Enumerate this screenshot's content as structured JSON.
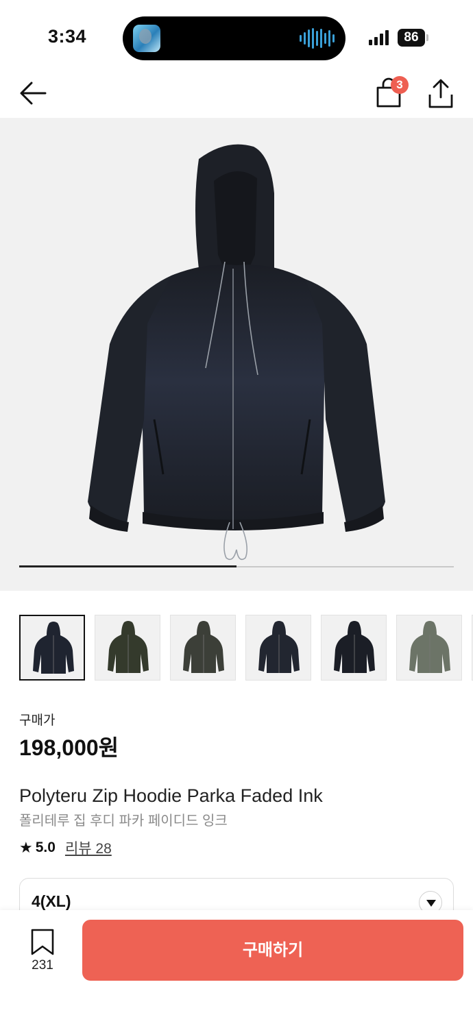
{
  "status_bar": {
    "time": "3:34",
    "battery": "86"
  },
  "header": {
    "back_icon": "arrow-left-icon",
    "cart_icon": "shopping-bag-icon",
    "cart_badge": "3",
    "share_icon": "share-icon"
  },
  "gallery": {
    "progress": 0.5,
    "thumbnail_count": 7,
    "active_thumbnail": 0
  },
  "product": {
    "price_label": "구매가",
    "price": "198,000원",
    "name_en": "Polyteru Zip Hoodie Parka Faded Ink",
    "name_ko": "폴리테루 집 후디 파카 페이디드 잉크",
    "rating": "5.0",
    "reviews_label": "리뷰 28"
  },
  "option": {
    "selected": "4(XL)"
  },
  "bottom_bar": {
    "bookmark_count": "231",
    "buy_label": "구매하기"
  },
  "colors": {
    "accent": "#ee6254",
    "badge": "#ee5f52",
    "jacket": "#1e2128"
  }
}
